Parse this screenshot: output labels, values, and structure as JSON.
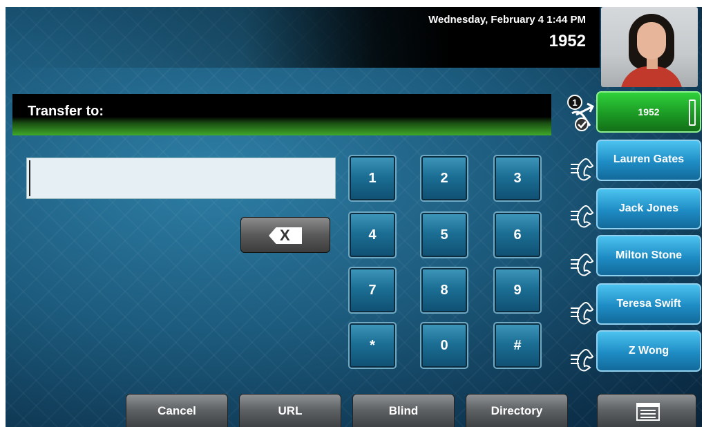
{
  "status": {
    "datetime": "Wednesday, February 4  1:44 PM",
    "extension": "1952"
  },
  "transfer": {
    "label": "Transfer to:",
    "input_value": "",
    "input_placeholder": ""
  },
  "keypad": [
    "1",
    "2",
    "3",
    "4",
    "5",
    "6",
    "7",
    "8",
    "9",
    "*",
    "0",
    "#"
  ],
  "lines": [
    {
      "label": "1952",
      "state": "active",
      "icon": "transfer-call-icon",
      "badge": "1"
    },
    {
      "label": "Lauren Gates",
      "state": "idle",
      "icon": "phone-handset-icon"
    },
    {
      "label": "Jack Jones",
      "state": "idle",
      "icon": "phone-handset-icon"
    },
    {
      "label": "Milton Stone",
      "state": "idle",
      "icon": "phone-handset-icon"
    },
    {
      "label": "Teresa Swift",
      "state": "idle",
      "icon": "phone-handset-icon"
    },
    {
      "label": "Z Wong",
      "state": "idle",
      "icon": "phone-handset-icon"
    }
  ],
  "softkeys": [
    {
      "label": "Cancel"
    },
    {
      "label": "URL"
    },
    {
      "label": "Blind"
    },
    {
      "label": "Directory"
    },
    {
      "label": "",
      "icon": "menu-icon"
    }
  ],
  "colors": {
    "active_line": "#1c9a25",
    "line_button": "#1e8cc4",
    "keypad_key": "#1c6f95"
  }
}
